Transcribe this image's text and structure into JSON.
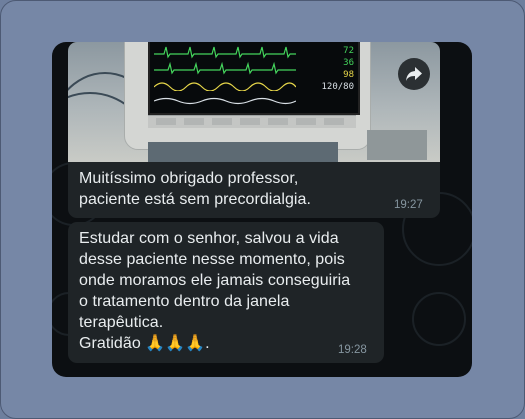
{
  "messages": [
    {
      "has_image": true,
      "image_description_icon": "patient-monitor-photo",
      "monitor_values": [
        "72",
        "36",
        "98",
        "120/80"
      ],
      "text": "Muitíssimo obrigado professor,\npaciente está sem precordialgia.",
      "time": "19:27"
    },
    {
      "has_image": false,
      "text": "Estudar com o senhor, salvou a vida\ndesse paciente nesse momento, pois\nonde moramos ele jamais conseguiria\no tratamento dentro da janela\nterapêutica.\nGratidão 🙏🙏🙏.",
      "time": "19:28"
    }
  ],
  "actions": {
    "forward_icon": "forward-arrow-icon"
  },
  "colors": {
    "outer_frame": "#7687a6",
    "chat_background": "#0c0f12",
    "bubble": "#1f2427",
    "text": "#e9edef",
    "timestamp": "#8696a0"
  }
}
